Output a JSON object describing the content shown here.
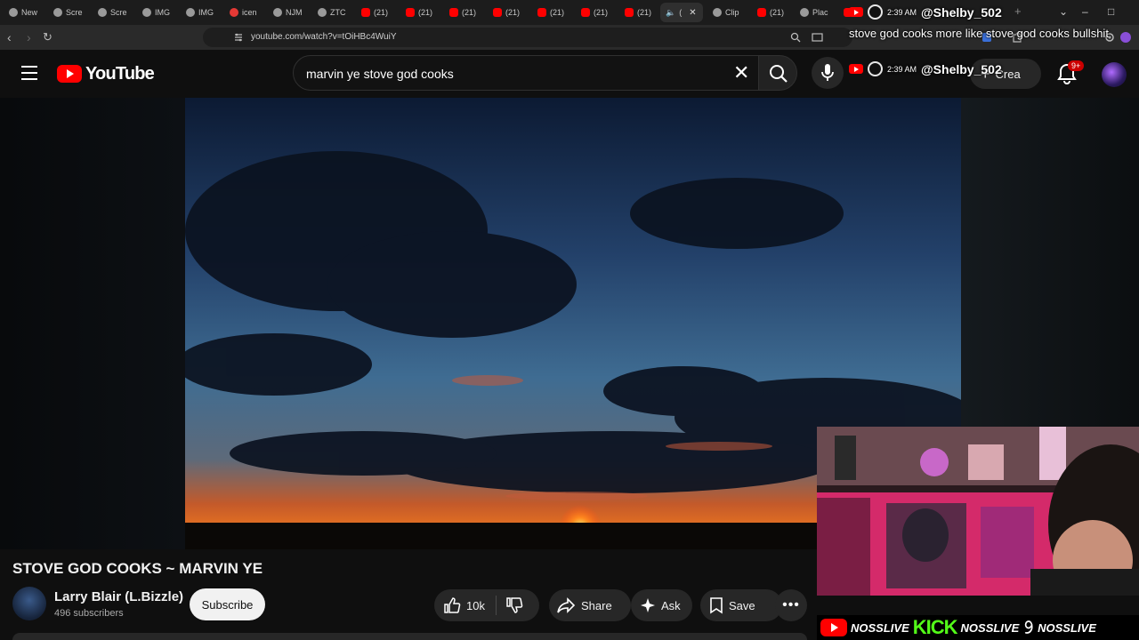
{
  "browser": {
    "tabs": [
      {
        "label": "New",
        "fav": "gray"
      },
      {
        "label": "Scre",
        "fav": "gray"
      },
      {
        "label": "Scre",
        "fav": "gray"
      },
      {
        "label": "IMG",
        "fav": "gray"
      },
      {
        "label": "IMG",
        "fav": "gray"
      },
      {
        "label": "icen",
        "fav": "red"
      },
      {
        "label": "NJM",
        "fav": "gray"
      },
      {
        "label": "ZTC",
        "fav": "gray"
      },
      {
        "label": "(21)",
        "fav": "yt"
      },
      {
        "label": "(21)",
        "fav": "yt"
      },
      {
        "label": "(21)",
        "fav": "yt"
      },
      {
        "label": "(21)",
        "fav": "yt"
      },
      {
        "label": "(21)",
        "fav": "yt"
      },
      {
        "label": "(21)",
        "fav": "yt"
      },
      {
        "label": "(21)",
        "fav": "yt"
      },
      {
        "label": "(",
        "fav": "gray",
        "active": true,
        "audio": true
      },
      {
        "label": "Clip",
        "fav": "gray"
      },
      {
        "label": "(21)",
        "fav": "yt"
      },
      {
        "label": "Plac",
        "fav": "gray"
      },
      {
        "label": "",
        "fav": "yt"
      }
    ],
    "new_tab": "+",
    "url": "youtube.com/watch?v=tOiHBc4WuiY"
  },
  "masthead": {
    "logo_text": "YouTube",
    "search_value": "marvin ye stove god cooks",
    "create_label": "Crea",
    "notifications_badge": "9+"
  },
  "chat": [
    {
      "time": "2:39 AM",
      "user": "@Shelby_502",
      "message": "stove god cooks more like stove god cooks bullshit"
    },
    {
      "time": "2:39 AM",
      "user": "@Shelby_502",
      "message": ""
    }
  ],
  "video": {
    "title": "STOVE GOD COOKS ~ MARVIN YE",
    "channel_name": "Larry Blair (L.Bizzle)",
    "subscribers": "496 subscribers",
    "subscribe_label": "Subscribe",
    "likes": "10k",
    "share_label": "Share",
    "ask_label": "Ask",
    "save_label": "Save"
  },
  "socials": [
    {
      "platform": "youtube",
      "name": "NOSSLIVE"
    },
    {
      "platform": "kick",
      "logo": "KICK",
      "name": "NOSSLIVE"
    },
    {
      "platform": "x",
      "name": "NOSSLIVE"
    }
  ],
  "colors": {
    "background": "#0f0f0f",
    "youtube_red": "#ff0000",
    "kick_green": "#53fc18",
    "button_gray": "#272727",
    "subscribe_bg": "#f1f1f1"
  }
}
